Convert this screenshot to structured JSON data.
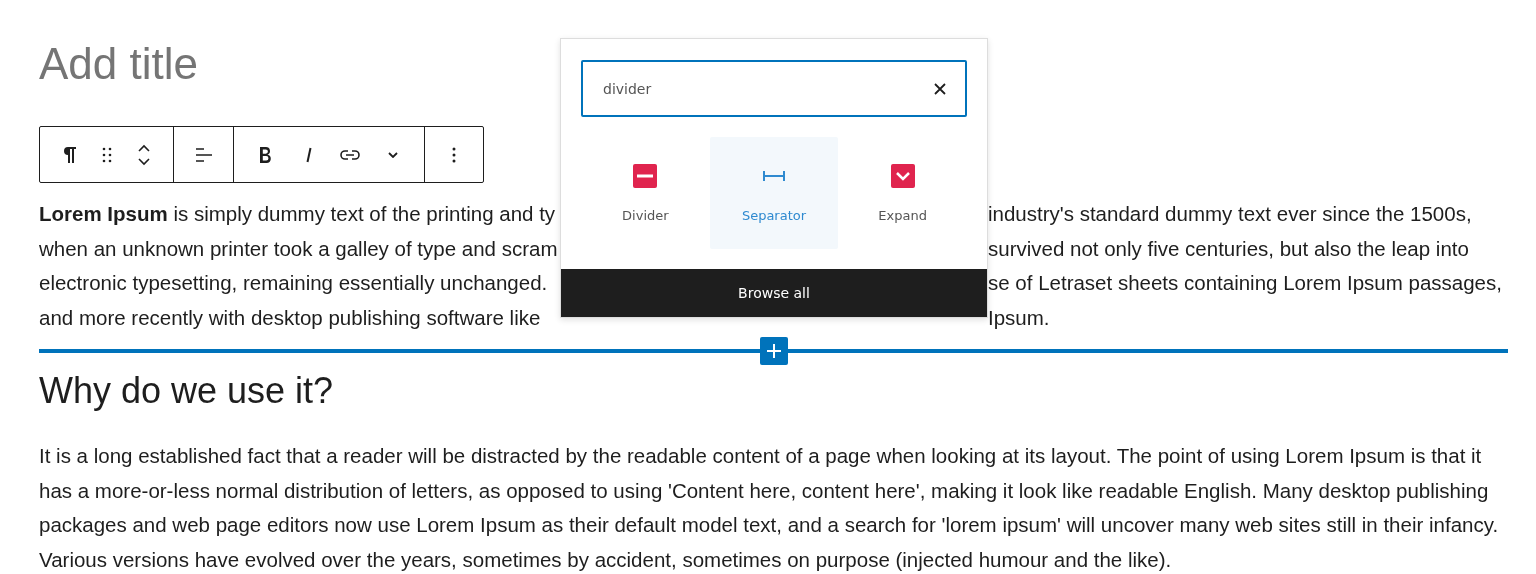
{
  "title_placeholder": "Add title",
  "intro_lines": [
    {
      "left": "**Lorem Ipsum** is simply dummy text of the printing and ty",
      "right": "industry's standard dummy text ever since the 1500s,"
    },
    {
      "left": "when an unknown printer took a galley of type and scram",
      "right": "survived not only five centuries, but also the leap into"
    },
    {
      "left": "electronic typesetting, remaining essentially unchanged.",
      "right": "se of Letraset sheets containing Lorem Ipsum passages,"
    },
    {
      "left": "and more recently with desktop publishing software like",
      "right": "Ipsum."
    }
  ],
  "heading": "Why do we use it?",
  "body": "It is a long established fact that a reader will be distracted by the readable content of a page when looking at its layout. The point of using Lorem Ipsum is that it has a more-or-less normal distribution of letters, as opposed to using 'Content here, content here', making it look like readable English. Many desktop publishing packages and web page editors now use Lorem Ipsum as their default model text, and a search for 'lorem ipsum' will uncover many web sites still in their infancy. Various versions have evolved over the years, sometimes by accident, sometimes on purpose (injected humour and the like).",
  "inserter": {
    "search": {
      "value": "divider"
    },
    "results": [
      {
        "label": "Divider",
        "kind": "divider",
        "selected": false
      },
      {
        "label": "Separator",
        "kind": "separator",
        "selected": true
      },
      {
        "label": "Expand",
        "kind": "expand",
        "selected": false
      }
    ],
    "browse_all": "Browse all"
  }
}
